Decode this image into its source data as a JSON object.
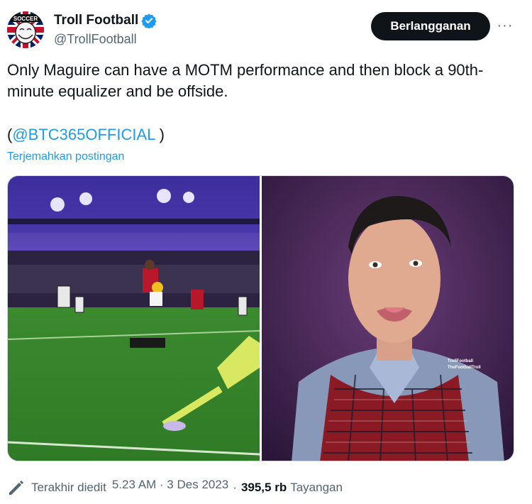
{
  "author": {
    "display_name": "Troll Football",
    "handle": "@TrollFootball",
    "avatar_icon": "troll-face-union-jack-avatar",
    "avatar_text": "SOCCER",
    "verified": true
  },
  "actions": {
    "subscribe_label": "Berlangganan",
    "more_label": "···"
  },
  "tweet": {
    "text": "Only Maguire can have a MOTM performance and then block a 90th-minute equalizer and be offside.",
    "mention_open": "(",
    "mention": "@BTC365OFFICIAL",
    "mention_close": " )",
    "translate_label": "Terjemahkan postingan"
  },
  "media": {
    "left_image": "football-match-night-stadium",
    "right_image": "player-portrait-plaid-vest",
    "watermark_line1": "TrollFootball",
    "watermark_line2": "TheFootballTroll"
  },
  "meta": {
    "edited_label": "Terakhir diedit",
    "timestamp": "5.23 AM · 3 Des 2023",
    "separator": "·",
    "views_count": "395,5 rb",
    "views_label": "Tayangan"
  },
  "colors": {
    "accent": "#1d9bf0",
    "text_primary": "#0f1419",
    "text_secondary": "#536471",
    "button_bg": "#0f1419"
  }
}
